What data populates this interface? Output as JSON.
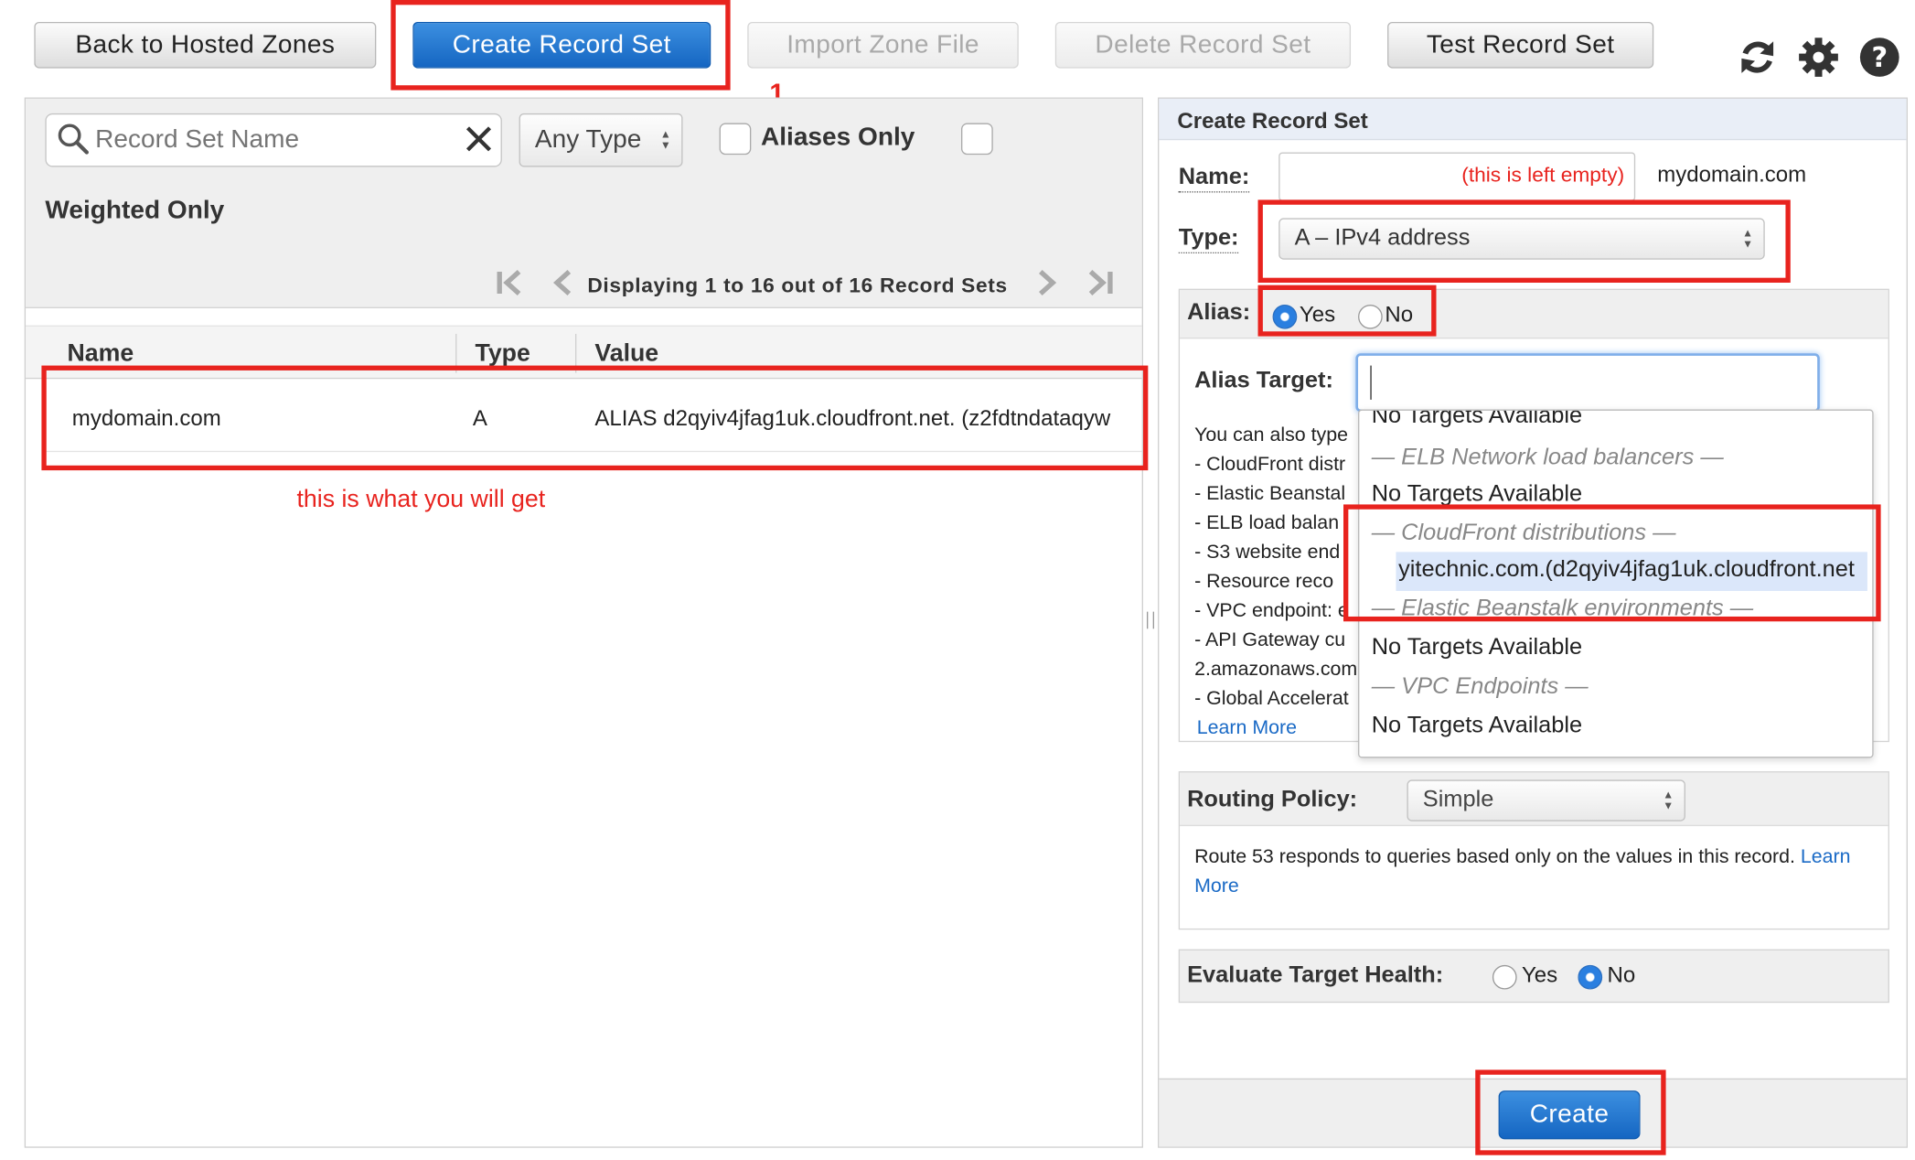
{
  "toolbar": {
    "back": "Back to Hosted Zones",
    "create": "Create Record Set",
    "import": "Import Zone File",
    "delete": "Delete Record Set",
    "test": "Test Record Set",
    "step": "1"
  },
  "filters": {
    "search_placeholder": "Record Set Name",
    "type": "Any Type",
    "aliases_only": "Aliases Only",
    "weighted_only": "Weighted Only"
  },
  "pagination": {
    "text": "Displaying 1 to 16 out of 16 Record Sets"
  },
  "table": {
    "headers": [
      "Name",
      "Type",
      "Value"
    ],
    "rows": [
      {
        "name": "mydomain.com",
        "type": "A",
        "value": "ALIAS d2qyiv4jfag1uk.cloudfront.net. (z2fdtndataqyw"
      }
    ]
  },
  "annotations": {
    "result": "this is what you will get",
    "name_empty": "(this is left empty)"
  },
  "form": {
    "title": "Create Record Set",
    "name_label": "Name:",
    "domain": "mydomain.com",
    "type_label": "Type:",
    "type_value": "A – IPv4 address",
    "alias_label": "Alias:",
    "yes": "Yes",
    "no": "No",
    "alias_target_label": "Alias Target:",
    "help_lines": [
      "You can also type",
      "-  CloudFront distr",
      "-  Elastic Beanstal",
      "-  ELB load balan",
      "-  S3 website end",
      "-  Resource reco",
      "-  VPC endpoint: e",
      "-  API Gateway cu",
      "2.amazonaws.com",
      "-  Global Accelerat"
    ],
    "learn_more": "Learn More",
    "routing_label": "Routing Policy:",
    "routing_value": "Simple",
    "routing_desc": "Route 53 responds to queries based only on the values in this record.",
    "learn": "Learn",
    "more": "More",
    "eval_label": "Evaluate Target Health:",
    "create_button": "Create"
  },
  "dropdown": {
    "top_partial": "No Targets Available",
    "elb_header": "— ELB Network load balancers —",
    "no_targets": "No Targets Available",
    "cf_header": "— CloudFront distributions —",
    "cf_item_obscured": "yitechnic.com.",
    "cf_item": "(d2qyiv4jfag1uk.cloudfront.net",
    "eb_header": "— Elastic Beanstalk environments —",
    "vpc_header": "— VPC Endpoints —"
  }
}
